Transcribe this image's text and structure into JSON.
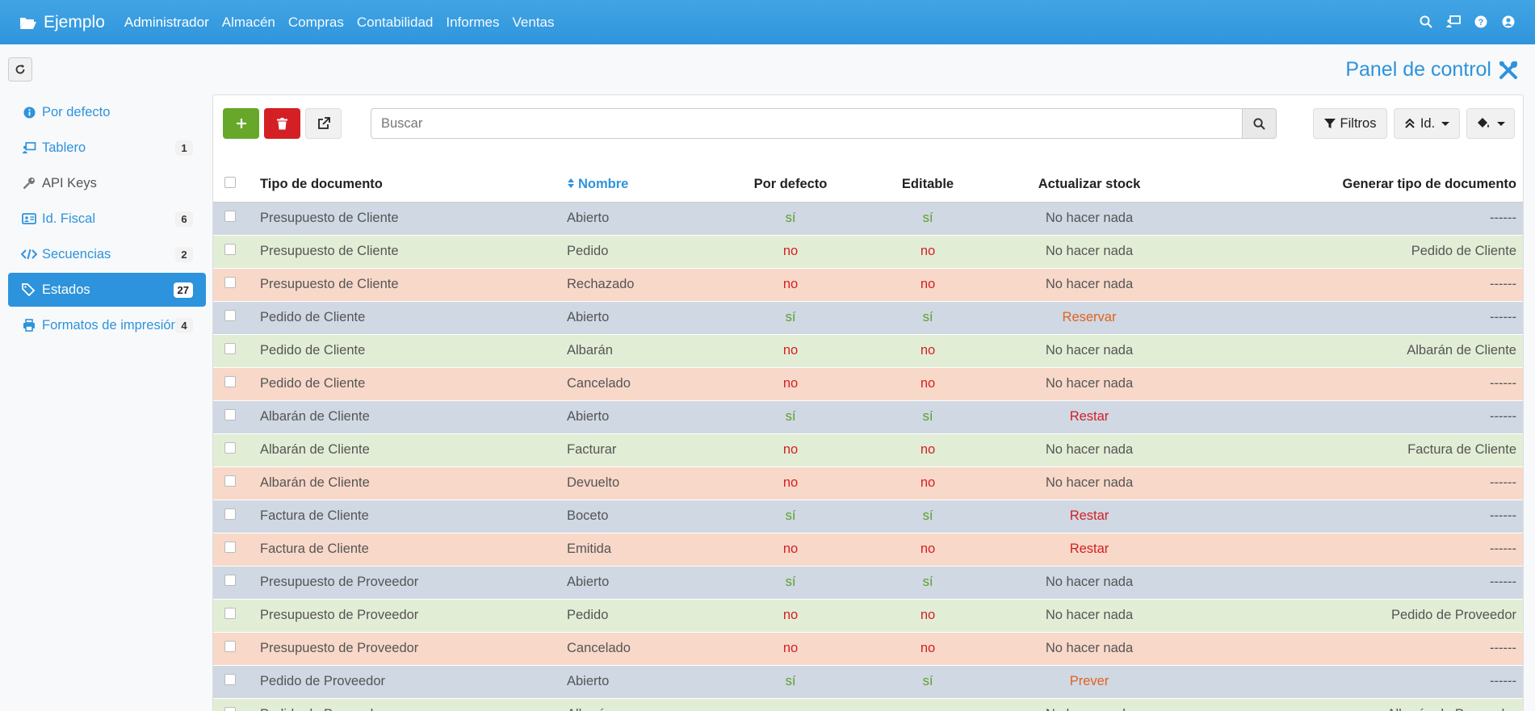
{
  "app": {
    "brand": "Ejemplo"
  },
  "nav": [
    "Administrador",
    "Almacén",
    "Compras",
    "Contabilidad",
    "Informes",
    "Ventas"
  ],
  "page_title": "Panel de control",
  "sidebar": [
    {
      "label": "Por defecto",
      "icon": "info-icon",
      "count": null
    },
    {
      "label": "Tablero",
      "icon": "chalkboard-icon",
      "count": "1"
    },
    {
      "label": "API Keys",
      "icon": "key-icon",
      "count": null
    },
    {
      "label": "Id. Fiscal",
      "icon": "id-card-icon",
      "count": "6"
    },
    {
      "label": "Secuencias",
      "icon": "code-icon",
      "count": "2"
    },
    {
      "label": "Estados",
      "icon": "tags-icon",
      "count": "27"
    },
    {
      "label": "Formatos de impresión",
      "icon": "print-icon",
      "count": "4"
    }
  ],
  "toolbar": {
    "search_placeholder": "Buscar",
    "filters_label": "Filtros",
    "sort_label": "Id."
  },
  "table": {
    "headers": {
      "tipo": "Tipo de documento",
      "nombre": "Nombre",
      "por_defecto": "Por defecto",
      "editable": "Editable",
      "stock": "Actualizar stock",
      "generar": "Generar tipo de documento"
    },
    "rows": [
      {
        "color": "blue",
        "tipo": "Presupuesto de Cliente",
        "nombre": "Abierto",
        "def": "sí",
        "edit": "sí",
        "stock": "No hacer nada",
        "stock_style": "normal",
        "gen": "------"
      },
      {
        "color": "green",
        "tipo": "Presupuesto de Cliente",
        "nombre": "Pedido",
        "def": "no",
        "edit": "no",
        "stock": "No hacer nada",
        "stock_style": "normal",
        "gen": "Pedido de Cliente"
      },
      {
        "color": "red",
        "tipo": "Presupuesto de Cliente",
        "nombre": "Rechazado",
        "def": "no",
        "edit": "no",
        "stock": "No hacer nada",
        "stock_style": "normal",
        "gen": "------"
      },
      {
        "color": "blue",
        "tipo": "Pedido de Cliente",
        "nombre": "Abierto",
        "def": "sí",
        "edit": "sí",
        "stock": "Reservar",
        "stock_style": "orange",
        "gen": "------"
      },
      {
        "color": "green",
        "tipo": "Pedido de Cliente",
        "nombre": "Albarán",
        "def": "no",
        "edit": "no",
        "stock": "No hacer nada",
        "stock_style": "normal",
        "gen": "Albarán de Cliente"
      },
      {
        "color": "red",
        "tipo": "Pedido de Cliente",
        "nombre": "Cancelado",
        "def": "no",
        "edit": "no",
        "stock": "No hacer nada",
        "stock_style": "normal",
        "gen": "------"
      },
      {
        "color": "blue",
        "tipo": "Albarán de Cliente",
        "nombre": "Abierto",
        "def": "sí",
        "edit": "sí",
        "stock": "Restar",
        "stock_style": "red",
        "gen": "------"
      },
      {
        "color": "green",
        "tipo": "Albarán de Cliente",
        "nombre": "Facturar",
        "def": "no",
        "edit": "no",
        "stock": "No hacer nada",
        "stock_style": "normal",
        "gen": "Factura de Cliente"
      },
      {
        "color": "red",
        "tipo": "Albarán de Cliente",
        "nombre": "Devuelto",
        "def": "no",
        "edit": "no",
        "stock": "No hacer nada",
        "stock_style": "normal",
        "gen": "------"
      },
      {
        "color": "blue",
        "tipo": "Factura de Cliente",
        "nombre": "Boceto",
        "def": "sí",
        "edit": "sí",
        "stock": "Restar",
        "stock_style": "red",
        "gen": "------"
      },
      {
        "color": "red",
        "tipo": "Factura de Cliente",
        "nombre": "Emitida",
        "def": "no",
        "edit": "no",
        "stock": "Restar",
        "stock_style": "red",
        "gen": "------"
      },
      {
        "color": "blue",
        "tipo": "Presupuesto de Proveedor",
        "nombre": "Abierto",
        "def": "sí",
        "edit": "sí",
        "stock": "No hacer nada",
        "stock_style": "normal",
        "gen": "------"
      },
      {
        "color": "green",
        "tipo": "Presupuesto de Proveedor",
        "nombre": "Pedido",
        "def": "no",
        "edit": "no",
        "stock": "No hacer nada",
        "stock_style": "normal",
        "gen": "Pedido de Proveedor"
      },
      {
        "color": "red",
        "tipo": "Presupuesto de Proveedor",
        "nombre": "Cancelado",
        "def": "no",
        "edit": "no",
        "stock": "No hacer nada",
        "stock_style": "normal",
        "gen": "------"
      },
      {
        "color": "blue",
        "tipo": "Pedido de Proveedor",
        "nombre": "Abierto",
        "def": "sí",
        "edit": "sí",
        "stock": "Prever",
        "stock_style": "orange",
        "gen": "------"
      },
      {
        "color": "green",
        "tipo": "Pedido de Proveedor",
        "nombre": "Albarán",
        "def": "no",
        "edit": "no",
        "stock": "No hacer nada",
        "stock_style": "normal",
        "gen": "Albarán de Proveedor"
      }
    ]
  }
}
